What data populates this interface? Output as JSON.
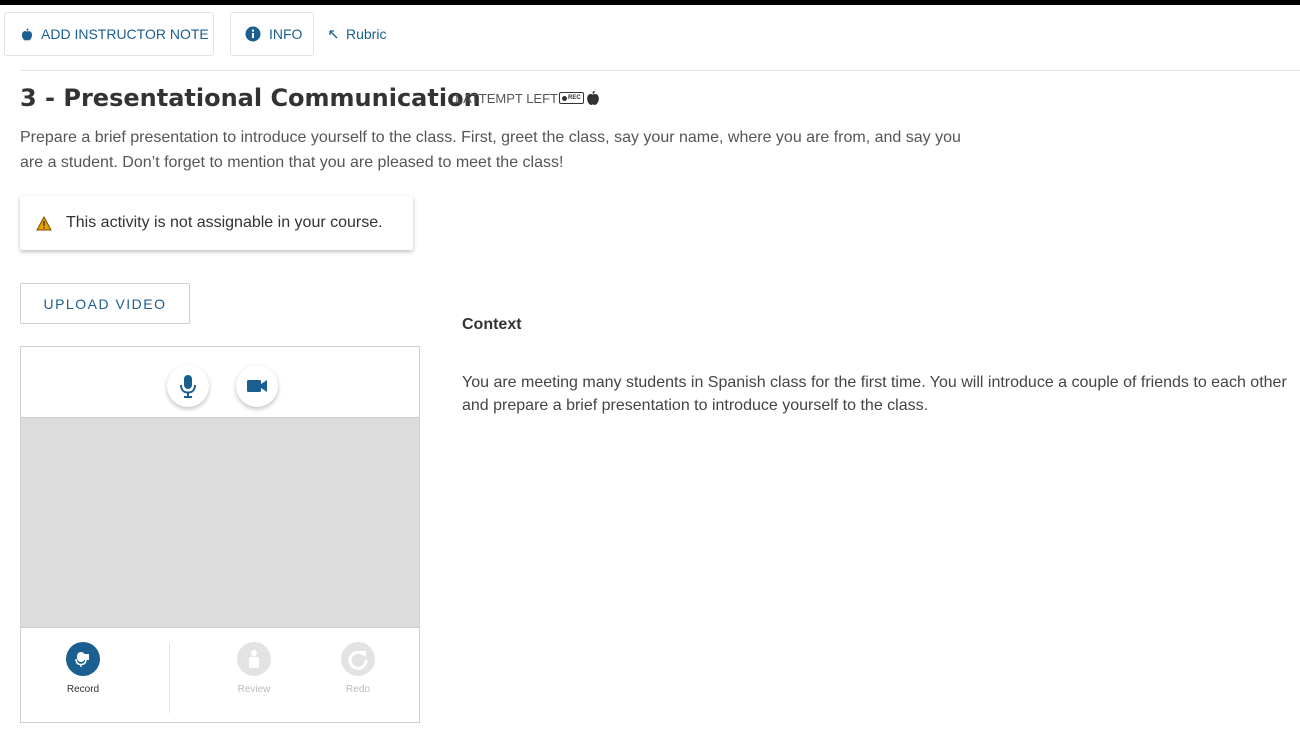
{
  "toolbar": {
    "instructor_note_label": "ADD INSTRUCTOR NOTE",
    "info_label": "INFO",
    "rubric_label": "Rubric"
  },
  "activity": {
    "title": "3 - Presentational Communication",
    "attempts_label": "1 ATTEMPT LEFT",
    "rec_badge": "REC",
    "description": "Prepare a brief presentation to introduce yourself to the class. First, greet the class, say your name, where you are from, and say you are a student. Don’t forget to mention that you are pleased to meet the class!"
  },
  "warning": {
    "text": "This activity is not assignable in your course."
  },
  "upload": {
    "label": "UPLOAD VIDEO"
  },
  "recorder": {
    "controls": {
      "record": "Record",
      "review": "Review",
      "redo": "Redo"
    }
  },
  "context": {
    "title": "Context",
    "text": "You are meeting many students in Spanish class for the first time. You will introduce a couple of friends to each other and prepare a brief presentation to introduce yourself to the class."
  },
  "colors": {
    "accent": "#1a5f8f",
    "warning": "#e8a200",
    "disabled": "#e0e0e0"
  }
}
